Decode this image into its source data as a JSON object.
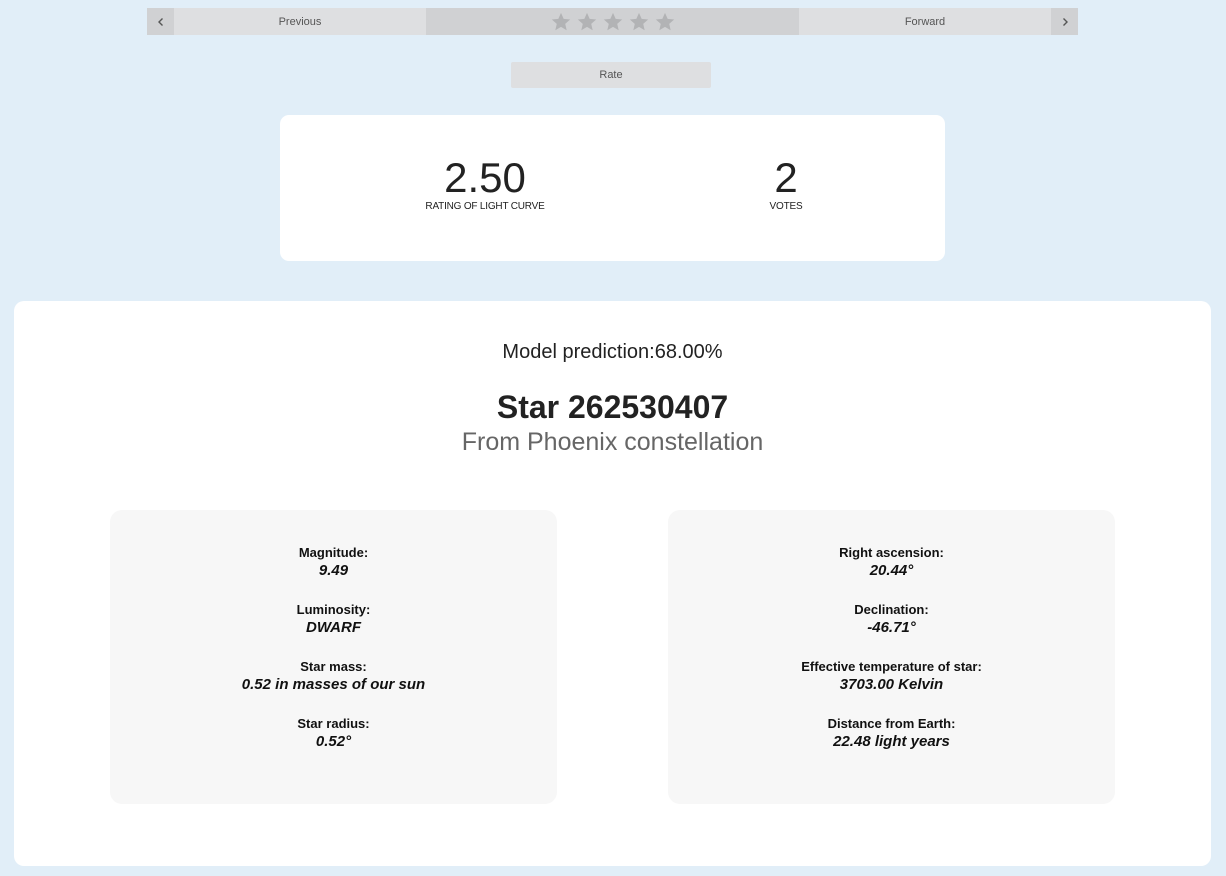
{
  "nav": {
    "prev_label": "Previous",
    "forward_label": "Forward",
    "stars_total": 5,
    "star_color": "#b2b3b5"
  },
  "rate_label": "Rate",
  "rating": {
    "value": "2.50",
    "value_label": "RATING OF LIGHT CURVE",
    "votes": "2",
    "votes_label": "VOTES"
  },
  "star": {
    "prediction": "Model prediction:68.00%",
    "title": "Star 262530407",
    "subtitle": "From Phoenix constellation"
  },
  "left_panel": [
    {
      "label": "Magnitude:",
      "value": "9.49"
    },
    {
      "label": "Luminosity:",
      "value": "DWARF"
    },
    {
      "label": "Star mass:",
      "value": "0.52 in masses of our sun"
    },
    {
      "label": "Star radius:",
      "value": "0.52°"
    }
  ],
  "right_panel": [
    {
      "label": "Right ascension:",
      "value": "20.44°"
    },
    {
      "label": "Declination:",
      "value": "-46.71°"
    },
    {
      "label": "Effective temperature of star:",
      "value": "3703.00 Kelvin"
    },
    {
      "label": "Distance from Earth:",
      "value": "22.48 light years"
    }
  ]
}
